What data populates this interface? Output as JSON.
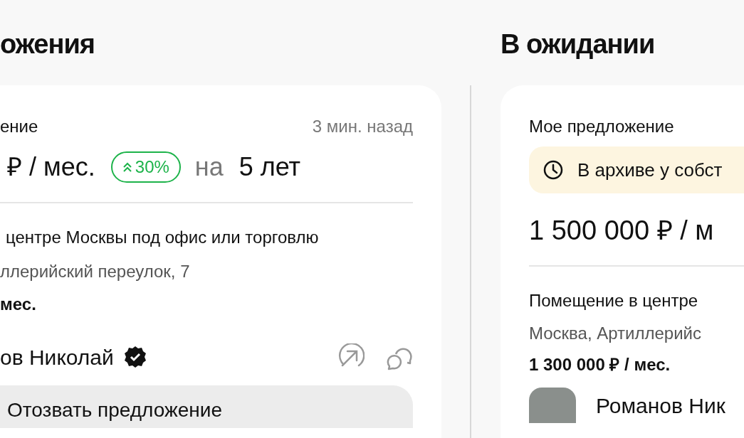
{
  "active_column": {
    "title": "ожения",
    "offer_label": "ение",
    "time": "3 мин. назад",
    "price": "₽ / мес.",
    "change_badge": "30%",
    "term_prefix": "на",
    "term": "5 лет",
    "listing_title": "центре Москвы под офис или торговлю",
    "address": "ллерийский переулок, 7",
    "listing_price": "мес.",
    "owner_name": "ов Николай",
    "owner_verified": true,
    "withdraw_button": "Отозвать предложение"
  },
  "pending_column": {
    "title": "В ожидании",
    "offer_label": "Мое предложение",
    "status": "В архиве у собст",
    "price": "1 500 000 ₽ / м",
    "listing_title": "Помещение в центре",
    "address": "Москва, Артиллерийс",
    "listing_price": "1 300 000 ₽ / мес.",
    "owner_name": "Романов Ник"
  }
}
